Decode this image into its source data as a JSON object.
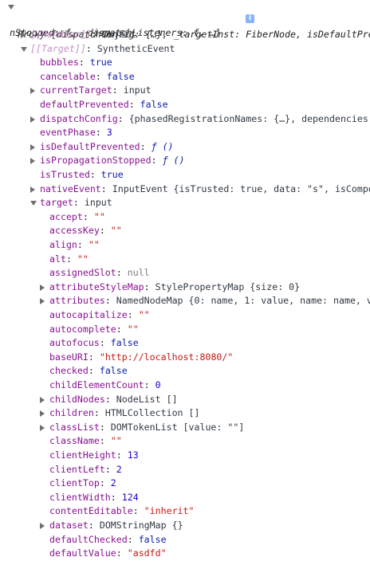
{
  "header": {
    "line1": "Proxy {dispatchConfig: {…}, _targetInst: FiberNode, isDefaultPrevented: f, isPropagatio",
    "line2": "nStopped: f, _dispatchListeners: f, …}",
    "info_glyph": "i"
  },
  "rows": [
    {
      "indent": 1,
      "arrow": "right",
      "key": "[[Handler]]",
      "value": "Object",
      "kind": "obj",
      "keyStyle": "internal"
    },
    {
      "indent": 1,
      "arrow": "down",
      "key": "[[Target]]",
      "value": "SyntheticEvent",
      "kind": "obj",
      "keyStyle": "internal"
    },
    {
      "indent": 2,
      "arrow": "",
      "key": "bubbles",
      "value": "true",
      "kind": "bool"
    },
    {
      "indent": 2,
      "arrow": "",
      "key": "cancelable",
      "value": "false",
      "kind": "bool"
    },
    {
      "indent": 2,
      "arrow": "right",
      "key": "currentTarget",
      "value": "input",
      "kind": "obj"
    },
    {
      "indent": 2,
      "arrow": "",
      "key": "defaultPrevented",
      "value": "false",
      "kind": "bool"
    },
    {
      "indent": 2,
      "arrow": "right",
      "key": "dispatchConfig",
      "value": "{phasedRegistrationNames: {…}, dependencies: Array(",
      "kind": "obj"
    },
    {
      "indent": 2,
      "arrow": "",
      "key": "eventPhase",
      "value": "3",
      "kind": "num"
    },
    {
      "indent": 2,
      "arrow": "right",
      "key": "isDefaultPrevented",
      "value": "ƒ ()",
      "kind": "func"
    },
    {
      "indent": 2,
      "arrow": "right",
      "key": "isPropagationStopped",
      "value": "ƒ ()",
      "kind": "func"
    },
    {
      "indent": 2,
      "arrow": "",
      "key": "isTrusted",
      "value": "true",
      "kind": "bool"
    },
    {
      "indent": 2,
      "arrow": "right",
      "key": "nativeEvent",
      "value": "InputEvent {isTrusted: true, data: \"s\", isComposing: fal",
      "kind": "obj"
    },
    {
      "indent": 2,
      "arrow": "down",
      "key": "target",
      "value": "input",
      "kind": "obj"
    },
    {
      "indent": 3,
      "arrow": "",
      "key": "accept",
      "value": "\"\"",
      "kind": "str"
    },
    {
      "indent": 3,
      "arrow": "",
      "key": "accessKey",
      "value": "\"\"",
      "kind": "str"
    },
    {
      "indent": 3,
      "arrow": "",
      "key": "align",
      "value": "\"\"",
      "kind": "str"
    },
    {
      "indent": 3,
      "arrow": "",
      "key": "alt",
      "value": "\"\"",
      "kind": "str"
    },
    {
      "indent": 3,
      "arrow": "",
      "key": "assignedSlot",
      "value": "null",
      "kind": "null"
    },
    {
      "indent": 3,
      "arrow": "right",
      "key": "attributeStyleMap",
      "value": "StylePropertyMap {size: 0}",
      "kind": "obj"
    },
    {
      "indent": 3,
      "arrow": "right",
      "key": "attributes",
      "value": "NamedNodeMap {0: name, 1: value, name: name, value: va",
      "kind": "obj"
    },
    {
      "indent": 3,
      "arrow": "",
      "key": "autocapitalize",
      "value": "\"\"",
      "kind": "str"
    },
    {
      "indent": 3,
      "arrow": "",
      "key": "autocomplete",
      "value": "\"\"",
      "kind": "str"
    },
    {
      "indent": 3,
      "arrow": "",
      "key": "autofocus",
      "value": "false",
      "kind": "bool"
    },
    {
      "indent": 3,
      "arrow": "",
      "key": "baseURI",
      "value": "\"http://localhost:8080/\"",
      "kind": "str"
    },
    {
      "indent": 3,
      "arrow": "",
      "key": "checked",
      "value": "false",
      "kind": "bool"
    },
    {
      "indent": 3,
      "arrow": "",
      "key": "childElementCount",
      "value": "0",
      "kind": "num"
    },
    {
      "indent": 3,
      "arrow": "right",
      "key": "childNodes",
      "value": "NodeList []",
      "kind": "obj"
    },
    {
      "indent": 3,
      "arrow": "right",
      "key": "children",
      "value": "HTMLCollection []",
      "kind": "obj"
    },
    {
      "indent": 3,
      "arrow": "right",
      "key": "classList",
      "value": "DOMTokenList [value: \"\"]",
      "kind": "obj"
    },
    {
      "indent": 3,
      "arrow": "",
      "key": "className",
      "value": "\"\"",
      "kind": "str"
    },
    {
      "indent": 3,
      "arrow": "",
      "key": "clientHeight",
      "value": "13",
      "kind": "num"
    },
    {
      "indent": 3,
      "arrow": "",
      "key": "clientLeft",
      "value": "2",
      "kind": "num"
    },
    {
      "indent": 3,
      "arrow": "",
      "key": "clientTop",
      "value": "2",
      "kind": "num"
    },
    {
      "indent": 3,
      "arrow": "",
      "key": "clientWidth",
      "value": "124",
      "kind": "num"
    },
    {
      "indent": 3,
      "arrow": "",
      "key": "contentEditable",
      "value": "\"inherit\"",
      "kind": "str"
    },
    {
      "indent": 3,
      "arrow": "right",
      "key": "dataset",
      "value": "DOMStringMap {}",
      "kind": "obj"
    },
    {
      "indent": 3,
      "arrow": "",
      "key": "defaultChecked",
      "value": "false",
      "kind": "bool"
    },
    {
      "indent": 3,
      "arrow": "",
      "key": "defaultValue",
      "value": "\"asdfd\"",
      "kind": "str"
    }
  ]
}
